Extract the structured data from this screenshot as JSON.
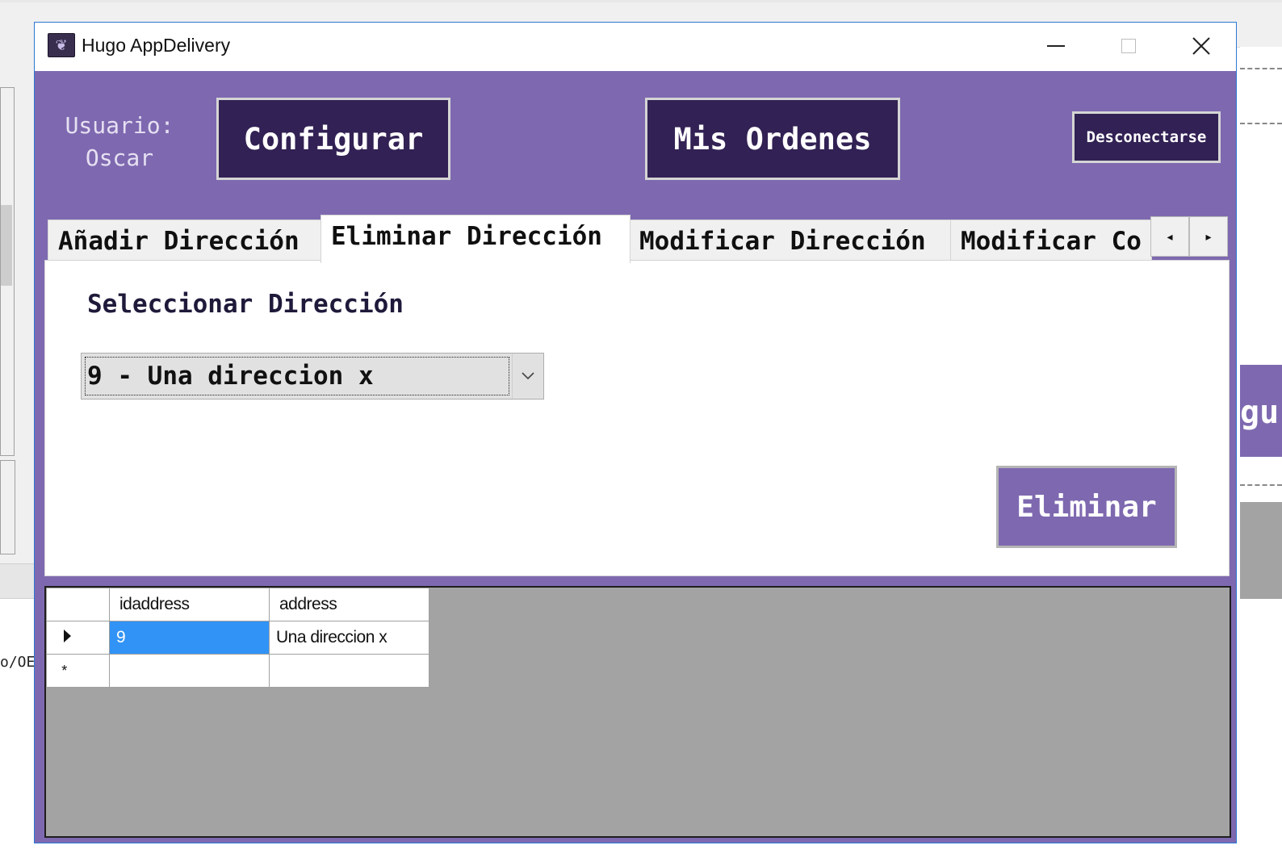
{
  "window": {
    "title": "Hugo AppDelivery",
    "controls": [
      "minimize",
      "maximize",
      "close"
    ]
  },
  "header": {
    "usuario_label": "Usuario:",
    "usuario_name": "Oscar",
    "configurar_label": "Configurar",
    "mis_ordenes_label": "Mis Ordenes",
    "desconectarse_label": "Desconectarse"
  },
  "tabs": [
    {
      "label": "Añadir Dirección",
      "active": false
    },
    {
      "label": "Eliminar Dirección",
      "active": true
    },
    {
      "label": "Modificar Dirección",
      "active": false
    },
    {
      "label": "Modificar Co",
      "active": false
    }
  ],
  "tab_scroll": {
    "left": "◂",
    "right": "▸"
  },
  "eliminar_tab": {
    "select_label": "Seleccionar Dirección",
    "selected_address": "9 - Una direccion x",
    "delete_button": "Eliminar"
  },
  "grid": {
    "columns": [
      "idaddress",
      "address"
    ],
    "rows": [
      {
        "idaddress": "9",
        "address": "Una direccion x",
        "current": true
      }
    ],
    "new_row_marker": "*"
  },
  "background": {
    "left_text": "o/OE",
    "right_text": "gu"
  },
  "colors": {
    "window_bg": "#7e69b0",
    "button_dark": "#322154",
    "selection": "#3193f5",
    "grid_bg": "#a3a3a3"
  }
}
